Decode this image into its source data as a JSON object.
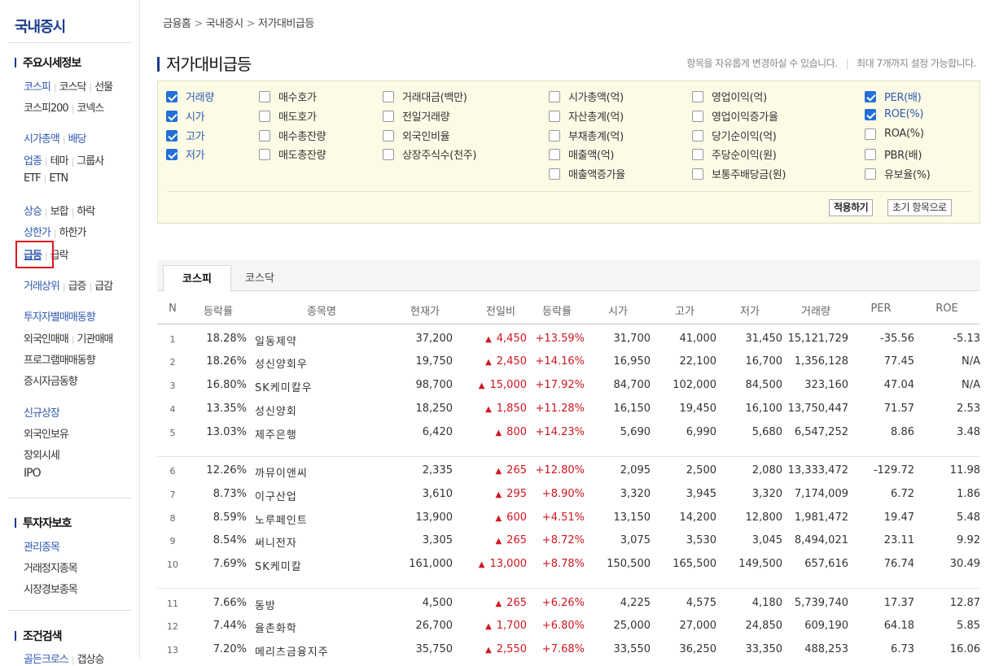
{
  "sidebar": {
    "title": "국내증시",
    "sections": [
      {
        "head": "주요시세정보"
      },
      {
        "head": "투자자보호"
      },
      {
        "head": "조건검색"
      }
    ],
    "links": {
      "kospi": "코스피",
      "kosdaq": "코스닥",
      "futures": "선물",
      "kospi200": "코스피200",
      "konex": "코넥스",
      "market_cap": "시가총액",
      "dividend": "배당",
      "sector": "업종",
      "theme": "테마",
      "group": "그룹사",
      "etf": "ETF",
      "etn": "ETN",
      "rise": "상승",
      "flat": "보합",
      "fall": "하락",
      "upper_limit": "상한가",
      "lower_limit": "하한가",
      "surge": "급등",
      "plunge": "급락",
      "top_volume": "거래상위",
      "vol_surge": "급증",
      "vol_drop": "급감",
      "investor_trading": "투자자별매매동향",
      "foreign_trading": "외국인매매",
      "institution_trading": "기관매매",
      "program_trading": "프로그램매매동향",
      "deposit_trend": "증시자금동향",
      "new_listing": "신규상장",
      "foreign_holding": "외국인보유",
      "otc": "장외시세",
      "ipo": "IPO",
      "managed": "관리종목",
      "suspended": "거래정지종목",
      "alert": "시장경보종목",
      "golden_cross": "골든크로스",
      "gap": "갭상승"
    }
  },
  "breadcrumb": [
    "금융홈",
    "국내증시",
    "저가대비급등"
  ],
  "page_title": "저가대비급등",
  "hint": {
    "left": "항목을 자유롭게 변경하실 수 있습니다.",
    "right": "최대 7개까지 설정 가능합니다."
  },
  "options": {
    "col1": [
      {
        "label": "거래량",
        "checked": true
      },
      {
        "label": "시가",
        "checked": true
      },
      {
        "label": "고가",
        "checked": true
      },
      {
        "label": "저가",
        "checked": true
      }
    ],
    "col2": [
      {
        "label": "매수호가",
        "checked": false
      },
      {
        "label": "매도호가",
        "checked": false
      },
      {
        "label": "매수총잔량",
        "checked": false
      },
      {
        "label": "매도총잔량",
        "checked": false
      }
    ],
    "col3": [
      {
        "label": "거래대금(백만)",
        "checked": false
      },
      {
        "label": "전일거래량",
        "checked": false
      },
      {
        "label": "외국인비율",
        "checked": false
      },
      {
        "label": "상장주식수(천주)",
        "checked": false
      }
    ],
    "col4": [
      {
        "label": "시가총액(억)",
        "checked": false
      },
      {
        "label": "자산총계(억)",
        "checked": false
      },
      {
        "label": "부채총계(억)",
        "checked": false
      },
      {
        "label": "매출액(억)",
        "checked": false
      },
      {
        "label": "매출액증가율",
        "checked": false
      }
    ],
    "col5": [
      {
        "label": "영업이익(억)",
        "checked": false
      },
      {
        "label": "영업이익증가율",
        "checked": false
      },
      {
        "label": "당기순이익(억)",
        "checked": false
      },
      {
        "label": "주당순이익(원)",
        "checked": false
      },
      {
        "label": "보통주배당금(원)",
        "checked": false
      }
    ],
    "col6": [
      {
        "label": "PER(배)",
        "checked": true
      },
      {
        "label": "ROE(%)",
        "checked": true
      },
      {
        "label": "ROA(%)",
        "checked": false
      },
      {
        "label": "PBR(배)",
        "checked": false
      },
      {
        "label": "유보율(%)",
        "checked": false
      }
    ],
    "apply_label": "적용하기",
    "reset_label": "초기 항목으로"
  },
  "tabs": [
    "코스피",
    "코스닥"
  ],
  "table": {
    "headers": [
      "N",
      "등락률",
      "종목명",
      "현재가",
      "전일비",
      "등락률",
      "시가",
      "고가",
      "저가",
      "거래량",
      "PER",
      "ROE"
    ],
    "rows": [
      [
        "1",
        "18.28%",
        "일동제약",
        "37,200",
        "4,450",
        "+13.59%",
        "31,700",
        "41,000",
        "31,450",
        "15,121,729",
        "-35.56",
        "-5.13"
      ],
      [
        "2",
        "18.26%",
        "성신양회우",
        "19,750",
        "2,450",
        "+14.16%",
        "16,950",
        "22,100",
        "16,700",
        "1,356,128",
        "77.45",
        "N/A"
      ],
      [
        "3",
        "16.80%",
        "SK케미칼우",
        "98,700",
        "15,000",
        "+17.92%",
        "84,700",
        "102,000",
        "84,500",
        "323,160",
        "47.04",
        "N/A"
      ],
      [
        "4",
        "13.35%",
        "성신양회",
        "18,250",
        "1,850",
        "+11.28%",
        "16,150",
        "19,450",
        "16,100",
        "13,750,447",
        "71.57",
        "2.53"
      ],
      [
        "5",
        "13.03%",
        "제주은행",
        "6,420",
        "800",
        "+14.23%",
        "5,690",
        "6,990",
        "5,680",
        "6,547,252",
        "8.86",
        "3.48"
      ],
      [
        "6",
        "12.26%",
        "까뮤이앤씨",
        "2,335",
        "265",
        "+12.80%",
        "2,095",
        "2,500",
        "2,080",
        "13,333,472",
        "-129.72",
        "11.98"
      ],
      [
        "7",
        "8.73%",
        "이구산업",
        "3,610",
        "295",
        "+8.90%",
        "3,320",
        "3,945",
        "3,320",
        "7,174,009",
        "6.72",
        "1.86"
      ],
      [
        "8",
        "8.59%",
        "노루페인트",
        "13,900",
        "600",
        "+4.51%",
        "13,150",
        "14,200",
        "12,800",
        "1,981,472",
        "19.47",
        "5.48"
      ],
      [
        "9",
        "8.54%",
        "써니전자",
        "3,305",
        "265",
        "+8.72%",
        "3,075",
        "3,530",
        "3,045",
        "8,494,021",
        "23.11",
        "9.92"
      ],
      [
        "10",
        "7.69%",
        "SK케미칼",
        "161,000",
        "13,000",
        "+8.78%",
        "150,500",
        "165,500",
        "149,500",
        "657,616",
        "76.74",
        "30.49"
      ],
      [
        "11",
        "7.66%",
        "동방",
        "4,500",
        "265",
        "+6.26%",
        "4,225",
        "4,575",
        "4,180",
        "5,739,740",
        "17.37",
        "12.87"
      ],
      [
        "12",
        "7.44%",
        "율촌화학",
        "26,700",
        "1,700",
        "+6.80%",
        "25,000",
        "27,000",
        "24,850",
        "609,190",
        "64.18",
        "5.85"
      ],
      [
        "13",
        "7.20%",
        "메리츠금융지주",
        "35,750",
        "2,550",
        "+7.68%",
        "33,550",
        "36,250",
        "33,350",
        "488,253",
        "6.73",
        "16.06"
      ]
    ]
  },
  "colors": {
    "accent": "#1c3d8a",
    "link": "#2f59b0",
    "up": "#d0161f",
    "highlight": "#e0141e",
    "option_bg": "#fbfbe6"
  },
  "icons": {
    "up_arrow": "▲",
    "breadcrumb_sep": ">"
  }
}
